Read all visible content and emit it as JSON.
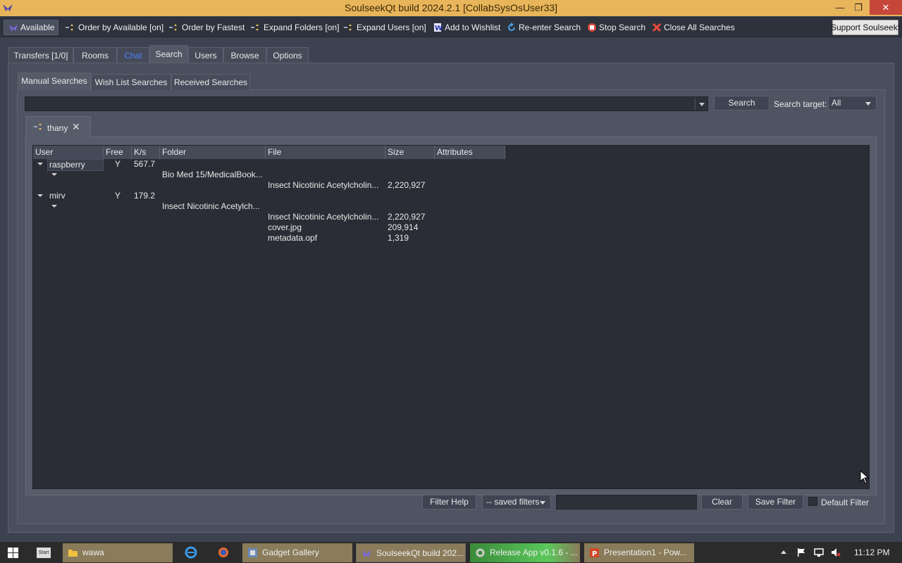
{
  "window": {
    "title": "SoulseekQt build 2024.2.1 [CollabSysOsUser33]",
    "minimize": "—",
    "restore": "❐",
    "close": "✕"
  },
  "toolbar": {
    "available": "Available",
    "order_available": "Order by Available [on]",
    "order_fastest": "Order by Fastest",
    "expand_folders": "Expand Folders [on]",
    "expand_users": "Expand Users [on]",
    "add_wishlist": "Add to Wishlist",
    "reenter_search": "Re-enter Search",
    "stop_search": "Stop Search",
    "close_all": "Close All Searches",
    "support": "Support Soulseek!"
  },
  "main_tabs": [
    "Transfers [1/0]",
    "Rooms",
    "Chat",
    "Search",
    "Users",
    "Browse",
    "Options"
  ],
  "sub_tabs": [
    "Manual Searches",
    "Wish List Searches",
    "Received Searches"
  ],
  "search": {
    "button": "Search",
    "target_label": "Search target:",
    "target_value": "All"
  },
  "result_tab": {
    "label": "thany",
    "close": "✕"
  },
  "table": {
    "headers": [
      "User",
      "Free",
      "K/s",
      "Folder",
      "File",
      "Size",
      "Attributes"
    ],
    "groups": [
      {
        "user": "raspberry",
        "free": "Y",
        "speed": "567.7",
        "folder": "Bio Med 15/MedicalBook...",
        "files": [
          {
            "name": "Insect Nicotinic Acetylcholin...",
            "size": "2,220,927"
          }
        ]
      },
      {
        "user": "mirv",
        "free": "Y",
        "speed": "179.2",
        "folder": "Insect Nicotinic Acetylch...",
        "files": [
          {
            "name": "Insect Nicotinic Acetylcholin...",
            "size": "2,220,927"
          },
          {
            "name": "cover.jpg",
            "size": "209,914"
          },
          {
            "name": "metadata.opf",
            "size": "1,319"
          }
        ]
      }
    ]
  },
  "filters": {
    "help": "Filter Help",
    "saved": "-- saved filters",
    "clear": "Clear",
    "save": "Save Filter",
    "default": "Default Filter"
  },
  "taskbar": {
    "start": "Start",
    "items": [
      "wawa",
      "Gadget Gallery",
      "SoulseekQt build 202...",
      "Release App v0.1.6 - ...",
      "Presentation1 - Pow..."
    ],
    "clock": "11:12 PM"
  }
}
